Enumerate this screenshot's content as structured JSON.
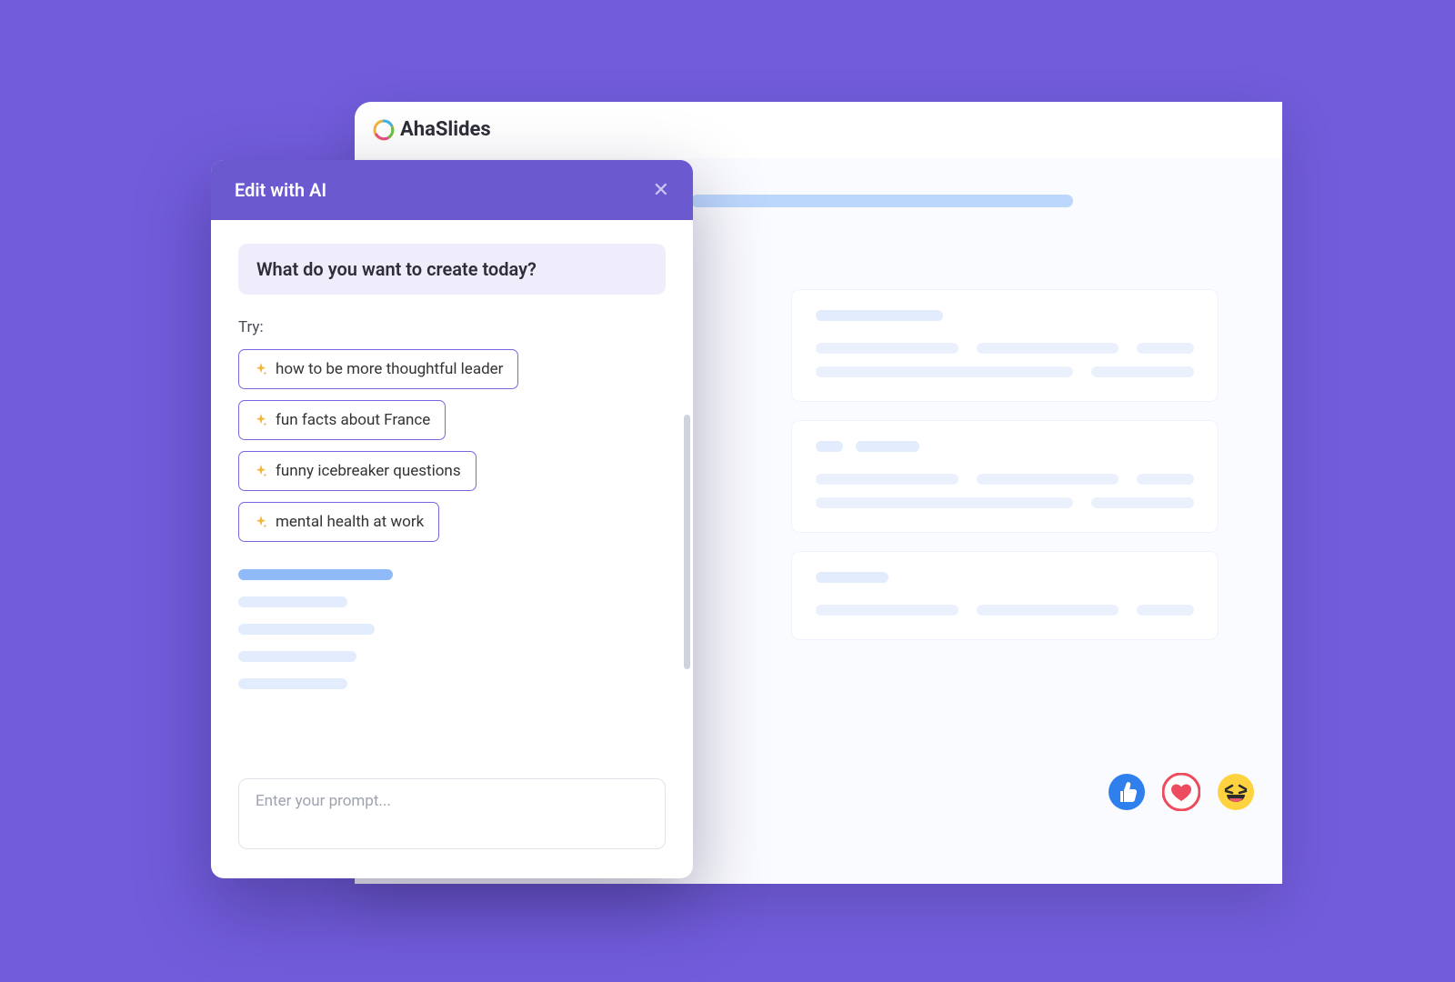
{
  "app": {
    "brand": "AhaSlides"
  },
  "dialog": {
    "title": "Edit with AI",
    "banner": "What do you want to create today?",
    "try_label": "Try:",
    "suggestions": [
      "how to be more thoughtful leader",
      "fun facts about France",
      "funny icebreaker questions",
      "mental health at work"
    ],
    "input_placeholder": "Enter your prompt..."
  },
  "reactions": {
    "like": "like-icon",
    "love": "love-icon",
    "laugh": "laugh-icon"
  }
}
